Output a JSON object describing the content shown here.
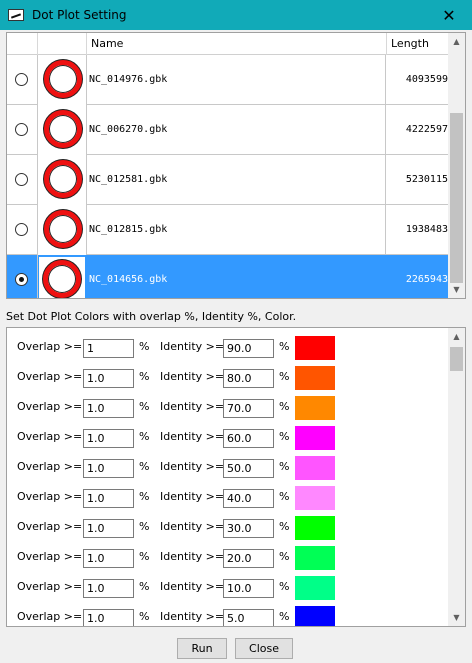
{
  "window": {
    "title": "Dot Plot Setting",
    "close_glyph": "✕"
  },
  "table": {
    "columns": {
      "name": "Name",
      "length": "Length"
    },
    "rows": [
      {
        "name": "NC_014976.gbk",
        "length": "4093599",
        "selected": false
      },
      {
        "name": "NC_006270.gbk",
        "length": "4222597",
        "selected": false
      },
      {
        "name": "NC_012581.gbk",
        "length": "5230115",
        "selected": false
      },
      {
        "name": "NC_012815.gbk",
        "length": "1938483",
        "selected": false
      },
      {
        "name": "NC_014656.gbk",
        "length": "2265943",
        "selected": true
      }
    ]
  },
  "settings": {
    "label": "Set Dot Plot Colors with overlap %, Identity %, Color.",
    "overlap_label": "Overlap >=",
    "identity_label": "Identity >=",
    "percent": "%",
    "rows": [
      {
        "overlap": "1",
        "identity": "90.0",
        "color": "#ff0000"
      },
      {
        "overlap": "1.0",
        "identity": "80.0",
        "color": "#ff5500"
      },
      {
        "overlap": "1.0",
        "identity": "70.0",
        "color": "#ff8800"
      },
      {
        "overlap": "1.0",
        "identity": "60.0",
        "color": "#ff00ff"
      },
      {
        "overlap": "1.0",
        "identity": "50.0",
        "color": "#ff55ff"
      },
      {
        "overlap": "1.0",
        "identity": "40.0",
        "color": "#ff88ff"
      },
      {
        "overlap": "1.0",
        "identity": "30.0",
        "color": "#00ff00"
      },
      {
        "overlap": "1.0",
        "identity": "20.0",
        "color": "#00ff55"
      },
      {
        "overlap": "1.0",
        "identity": "10.0",
        "color": "#00ff88"
      },
      {
        "overlap": "1.0",
        "identity": "5.0",
        "color": "#0000ff"
      }
    ]
  },
  "buttons": {
    "run": "Run",
    "close": "Close"
  },
  "colors": {
    "titlebar": "#11aab8",
    "selection": "#3399ff",
    "ring": "#ee1111"
  }
}
